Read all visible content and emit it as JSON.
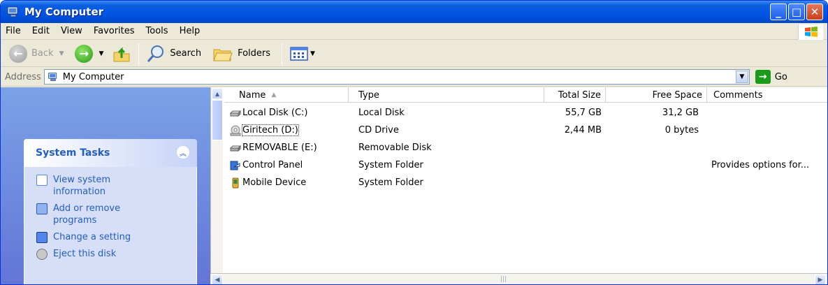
{
  "window": {
    "title": "My Computer"
  },
  "menu": [
    "File",
    "Edit",
    "View",
    "Favorites",
    "Tools",
    "Help"
  ],
  "toolbar": {
    "back": "Back",
    "search": "Search",
    "folders": "Folders"
  },
  "address": {
    "label": "Address",
    "value": "My Computer",
    "go": "Go"
  },
  "tasks": {
    "title": "System Tasks",
    "items": [
      {
        "label": "View system information",
        "icon": "system-info-icon"
      },
      {
        "label": "Add or remove programs",
        "icon": "add-remove-icon"
      },
      {
        "label": "Change a setting",
        "icon": "control-panel-icon"
      },
      {
        "label": "Eject this disk",
        "icon": "eject-icon"
      }
    ]
  },
  "columns": {
    "name": "Name",
    "type": "Type",
    "total": "Total Size",
    "free": "Free Space",
    "comments": "Comments"
  },
  "rows": [
    {
      "name": "Local Disk (C:)",
      "type": "Local Disk",
      "total": "55,7 GB",
      "free": "31,2 GB",
      "comments": "",
      "icon": "hard-disk-icon"
    },
    {
      "name": "Giritech (D:)",
      "type": "CD Drive",
      "total": "2,44 MB",
      "free": "0 bytes",
      "comments": "",
      "icon": "cd-drive-icon"
    },
    {
      "name": "REMOVABLE (E:)",
      "type": "Removable Disk",
      "total": "",
      "free": "",
      "comments": "",
      "icon": "removable-disk-icon"
    },
    {
      "name": "Control Panel",
      "type": "System Folder",
      "total": "",
      "free": "",
      "comments": "Provides options for...",
      "icon": "control-panel-icon"
    },
    {
      "name": "Mobile Device",
      "type": "System Folder",
      "total": "",
      "free": "",
      "comments": "",
      "icon": "mobile-device-icon"
    }
  ]
}
